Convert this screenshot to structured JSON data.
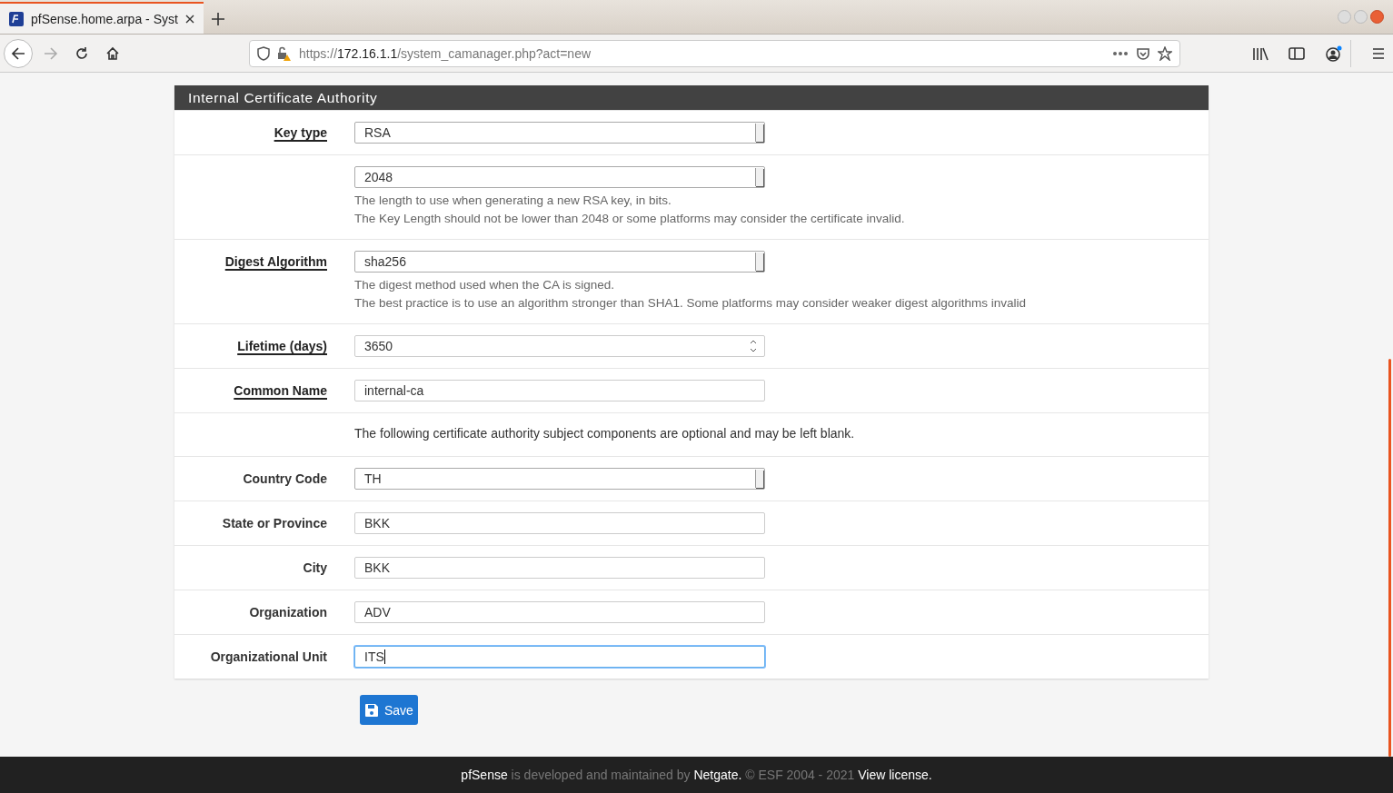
{
  "browser": {
    "tab": {
      "title": "pfSense.home.arpa - Syst",
      "selected": true
    },
    "url": {
      "scheme": "https://",
      "host": "172.16.1.1",
      "path": "/system_camanager.php?act=new"
    }
  },
  "panel": {
    "title": "Internal Certificate Authority",
    "rows": [
      {
        "kind": "select",
        "label": "Key type",
        "help_link": true,
        "value": "RSA"
      },
      {
        "kind": "select",
        "value": "2048",
        "help": [
          "The length to use when generating a new RSA key, in bits.",
          "The Key Length should not be lower than 2048 or some platforms may consider the certificate invalid."
        ]
      },
      {
        "kind": "select",
        "label": "Digest Algorithm",
        "help_link": true,
        "value": "sha256",
        "help": [
          "The digest method used when the CA is signed.",
          "The best practice is to use an algorithm stronger than SHA1. Some platforms may consider weaker digest algorithms invalid"
        ]
      },
      {
        "kind": "number",
        "label": "Lifetime (days)",
        "help_link": true,
        "value": "3650"
      },
      {
        "kind": "text",
        "label": "Common Name",
        "help_link": true,
        "value": "internal-ca",
        "focused": false
      },
      {
        "kind": "note",
        "text": "The following certificate authority subject components are optional and may be left blank."
      },
      {
        "kind": "select",
        "label": "Country Code",
        "help_link": false,
        "value": "TH"
      },
      {
        "kind": "text",
        "label": "State or Province",
        "help_link": false,
        "value": "BKK",
        "focused": false
      },
      {
        "kind": "text",
        "label": "City",
        "help_link": false,
        "value": "BKK",
        "focused": false
      },
      {
        "kind": "text",
        "label": "Organization",
        "help_link": false,
        "value": "ADV",
        "focused": false
      },
      {
        "kind": "text",
        "label": "Organizational Unit",
        "help_link": false,
        "value": "ITS",
        "focused": true
      }
    ]
  },
  "save_button": "Save",
  "footer": [
    {
      "kind": "link",
      "text": "pfSense"
    },
    {
      "kind": "text",
      "text": " is developed and maintained by "
    },
    {
      "kind": "link",
      "text": "Netgate."
    },
    {
      "kind": "text",
      "text": " © ESF 2004 - 2021 "
    },
    {
      "kind": "link",
      "text": "View license."
    }
  ]
}
